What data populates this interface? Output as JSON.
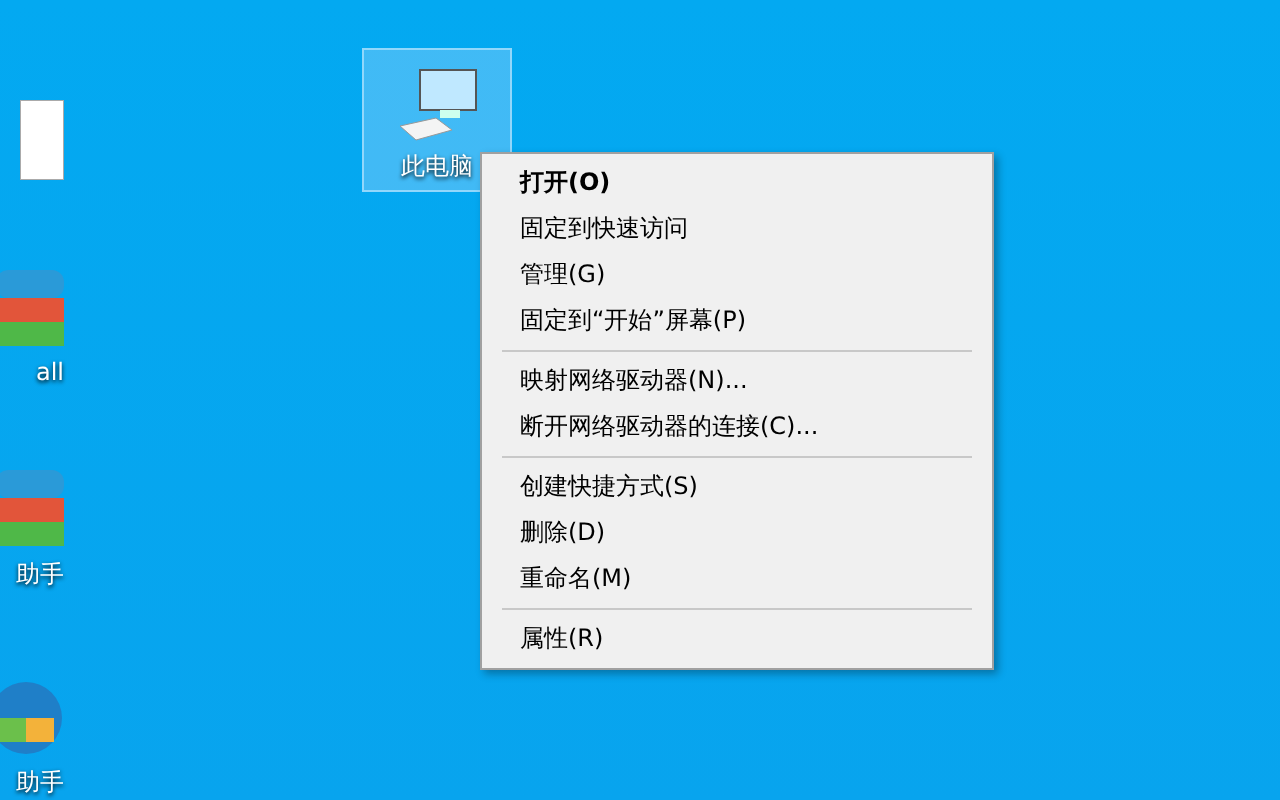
{
  "desktop_icons": [
    {
      "kind": "document",
      "selected": false
    },
    {
      "label": "all",
      "kind": "installer",
      "selected": false
    },
    {
      "label": "助手",
      "kind": "installer",
      "selected": false
    },
    {
      "label": "助手",
      "kind": "setup",
      "selected": false
    },
    {
      "label": "此电脑",
      "kind": "computer",
      "selected": true
    }
  ],
  "context_menu": {
    "items": [
      {
        "kind": "item",
        "label": "打开(O)",
        "default": true
      },
      {
        "kind": "item",
        "label": "固定到快速访问",
        "default": false
      },
      {
        "kind": "item",
        "label": "管理(G)",
        "default": false
      },
      {
        "kind": "item",
        "label": "固定到“开始”屏幕(P)",
        "default": false
      },
      {
        "kind": "separator"
      },
      {
        "kind": "item",
        "label": "映射网络驱动器(N)...",
        "default": false
      },
      {
        "kind": "item",
        "label": "断开网络驱动器的连接(C)...",
        "default": false
      },
      {
        "kind": "separator"
      },
      {
        "kind": "item",
        "label": "创建快捷方式(S)",
        "default": false
      },
      {
        "kind": "item",
        "label": "删除(D)",
        "default": false
      },
      {
        "kind": "item",
        "label": "重命名(M)",
        "default": false
      },
      {
        "kind": "separator"
      },
      {
        "kind": "item",
        "label": "属性(R)",
        "default": false
      }
    ]
  }
}
